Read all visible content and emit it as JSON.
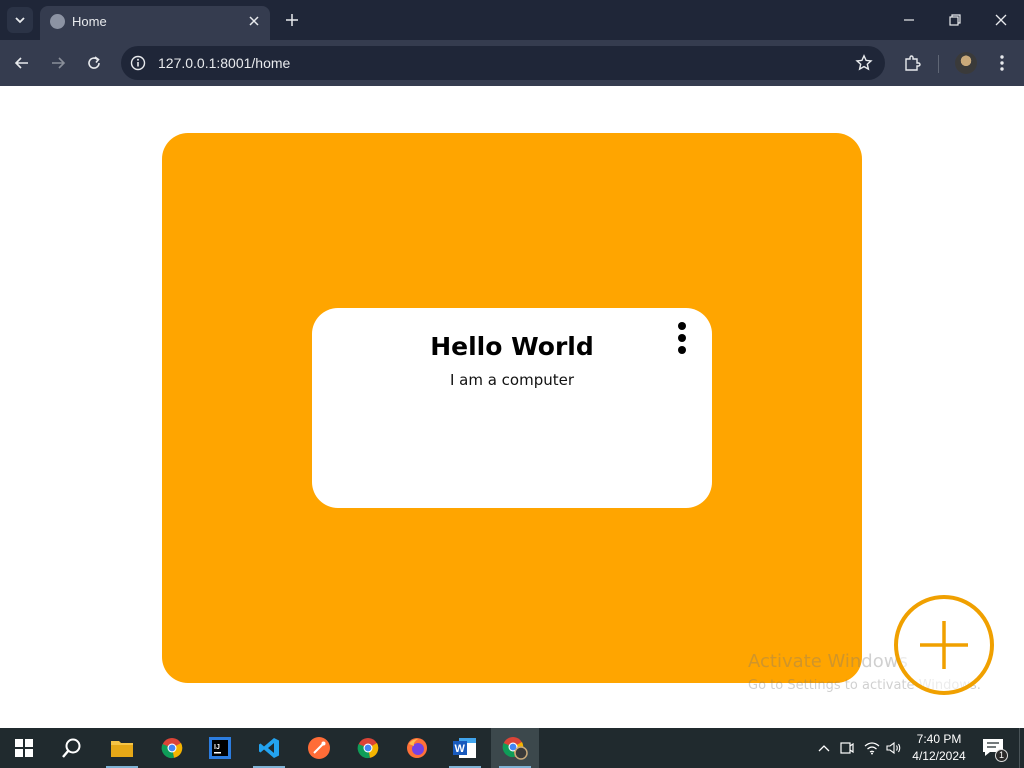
{
  "browser": {
    "tab": {
      "title": "Home"
    },
    "url": "127.0.0.1:8001/home"
  },
  "page": {
    "card": {
      "title": "Hello World",
      "subtitle": "I am a computer"
    }
  },
  "watermark": {
    "title": "Activate Windows",
    "subtitle": "Go to Settings to activate Windows."
  },
  "taskbar": {
    "apps": [
      "start-icon",
      "search-icon",
      "file-explorer-icon",
      "chrome-icon",
      "intellij-icon",
      "vscode-icon",
      "postman-icon",
      "chrome-icon",
      "firefox-icon",
      "word-icon",
      "chrome-profile-icon"
    ],
    "time": "7:40 PM",
    "date": "4/12/2024",
    "notification_count": "1"
  },
  "colors": {
    "panel": "#ffa500",
    "fab_border": "#f0a000",
    "browser_dark": "#1f2638",
    "browser_toolbar": "#353c4f",
    "taskbar": "#202a2e"
  }
}
